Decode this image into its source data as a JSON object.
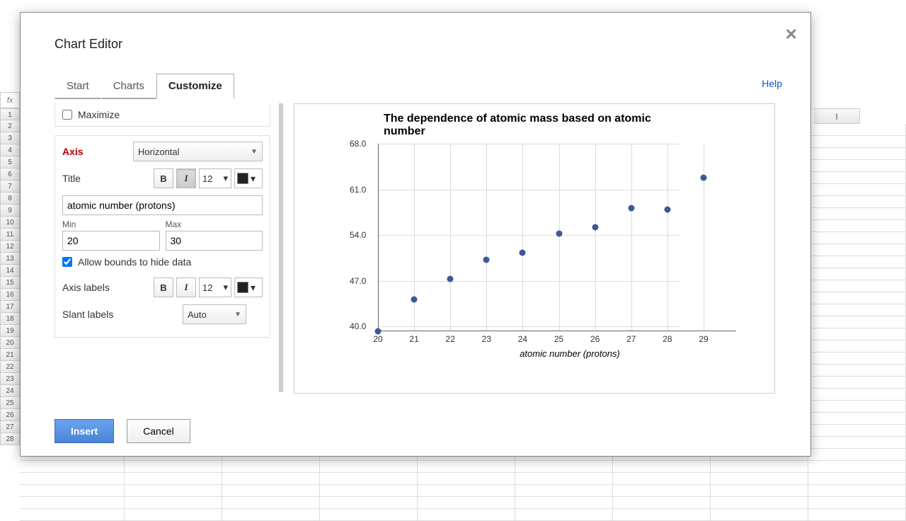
{
  "sheet": {
    "fx": "fx",
    "col_labels": [
      "I"
    ],
    "row_start": 1,
    "row_count": 28
  },
  "modal": {
    "title": "Chart Editor"
  },
  "tabs": {
    "items": [
      "Start",
      "Charts",
      "Customize"
    ],
    "active": 2
  },
  "help": "Help",
  "panel": {
    "maximize_label": "Maximize",
    "maximize_checked": false,
    "axis_label": "Axis",
    "axis_value": "Horizontal",
    "title_label": "Title",
    "title_fontsize": "12",
    "title_value": "atomic number (protons)",
    "min_label": "Min",
    "min_value": "20",
    "max_label": "Max",
    "max_value": "30",
    "allow_bounds_label": "Allow bounds to hide data",
    "allow_bounds_checked": true,
    "axis_labels_label": "Axis labels",
    "axis_labels_fontsize": "12",
    "slant_label": "Slant labels",
    "slant_value": "Auto"
  },
  "buttons": {
    "insert": "Insert",
    "cancel": "Cancel"
  },
  "preview_xlabel": "atomic number (protons)",
  "chart_data": {
    "type": "scatter",
    "title": "The dependence of atomic mass based on atomic number",
    "xlabel": "atomic number (protons)",
    "ylabel": "",
    "x": [
      20,
      21,
      22,
      23,
      24,
      25,
      26,
      27,
      28,
      29
    ],
    "y": [
      40.0,
      44.9,
      48.0,
      51.0,
      52.0,
      55.0,
      56.0,
      58.9,
      58.7,
      63.5
    ],
    "xlim": [
      20,
      29
    ],
    "ylim": [
      40.0,
      68.0
    ],
    "xticks": [
      20,
      21,
      22,
      23,
      24,
      25,
      26,
      27,
      28,
      29
    ],
    "yticks": [
      40.0,
      47.0,
      54.0,
      61.0,
      68.0
    ]
  }
}
